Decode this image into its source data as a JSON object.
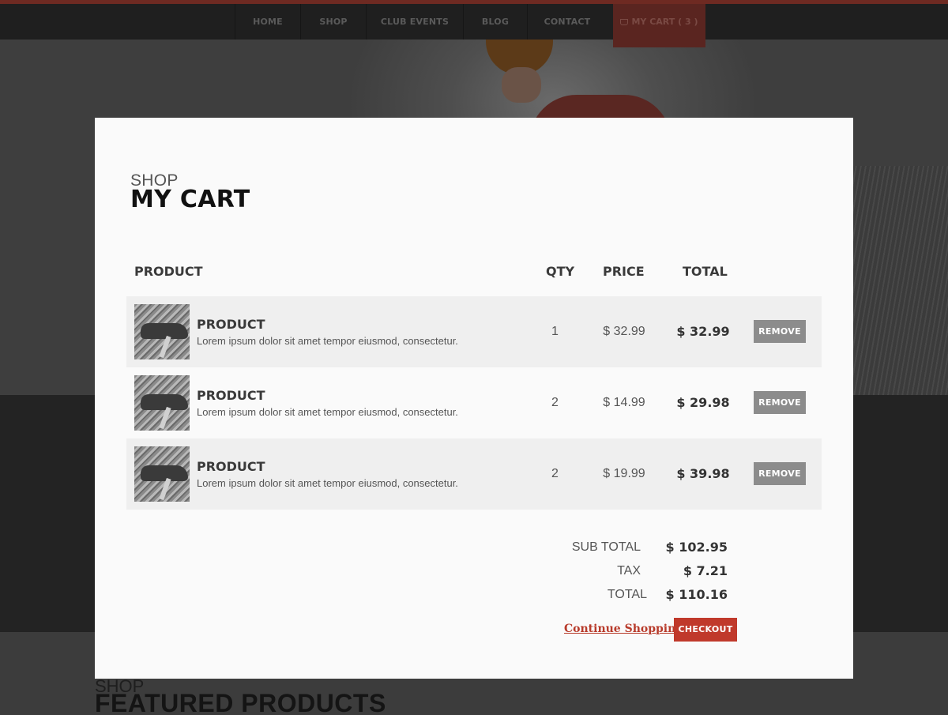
{
  "nav": {
    "items": [
      {
        "label": "HOME"
      },
      {
        "label": "SHOP"
      },
      {
        "label": "CLUB EVENTS"
      },
      {
        "label": "BLOG"
      },
      {
        "label": "CONTACT"
      }
    ],
    "cart_label": "MY CART ( 3 )"
  },
  "background": {
    "kicker": "SHOP",
    "heading": "FEATURED PRODUCTS"
  },
  "cart": {
    "kicker": "SHOP",
    "title": "MY CART",
    "columns": {
      "product": "PRODUCT",
      "qty": "QTY",
      "price": "PRICE",
      "total": "TOTAL"
    },
    "rows": [
      {
        "name": "PRODUCT",
        "description": "Lorem ipsum dolor sit amet tempor eiusmod, consectetur.",
        "qty": "1",
        "price": "$ 32.99",
        "total": "$ 32.99",
        "remove_label": "REMOVE"
      },
      {
        "name": "PRODUCT",
        "description": "Lorem ipsum dolor sit amet tempor eiusmod, consectetur.",
        "qty": "2",
        "price": "$ 14.99",
        "total": "$ 29.98",
        "remove_label": "REMOVE"
      },
      {
        "name": "PRODUCT",
        "description": "Lorem ipsum dolor sit amet tempor eiusmod, consectetur.",
        "qty": "2",
        "price": "$ 19.99",
        "total": "$ 39.98",
        "remove_label": "REMOVE"
      }
    ],
    "summary": {
      "subtotal_label": "SUB TOTAL",
      "subtotal_value": "$ 102.95",
      "tax_label": "TAX",
      "tax_value": "$ 7.21",
      "total_label": "TOTAL",
      "total_value": "$ 110.16"
    },
    "continue_label": "Continue Shopping",
    "checkout_label": "CHECKOUT"
  },
  "colors": {
    "accent": "#c0392b",
    "remove_button": "#8c8c8c",
    "row_alt": "#efefef"
  }
}
